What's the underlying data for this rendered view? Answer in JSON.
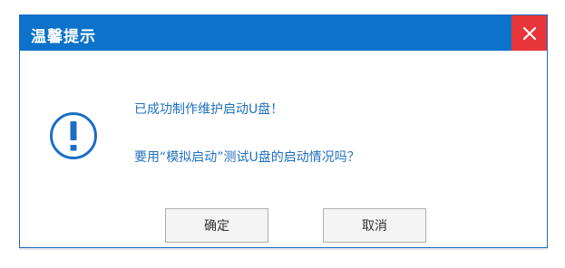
{
  "dialog": {
    "title": "温馨提示",
    "close_icon": "close-icon",
    "alert_icon": "exclamation-circle-icon",
    "message_line1": "已成功制作维护启动U盘！",
    "message_line2": "要用“模拟启动”测试U盘的启动情况吗？",
    "ok_label": "确定",
    "cancel_label": "取消"
  },
  "colors": {
    "titlebar": "#0d72c9",
    "close_button": "#e8353a",
    "message_text": "#1f6fc0",
    "icon": "#1a6fc4"
  }
}
